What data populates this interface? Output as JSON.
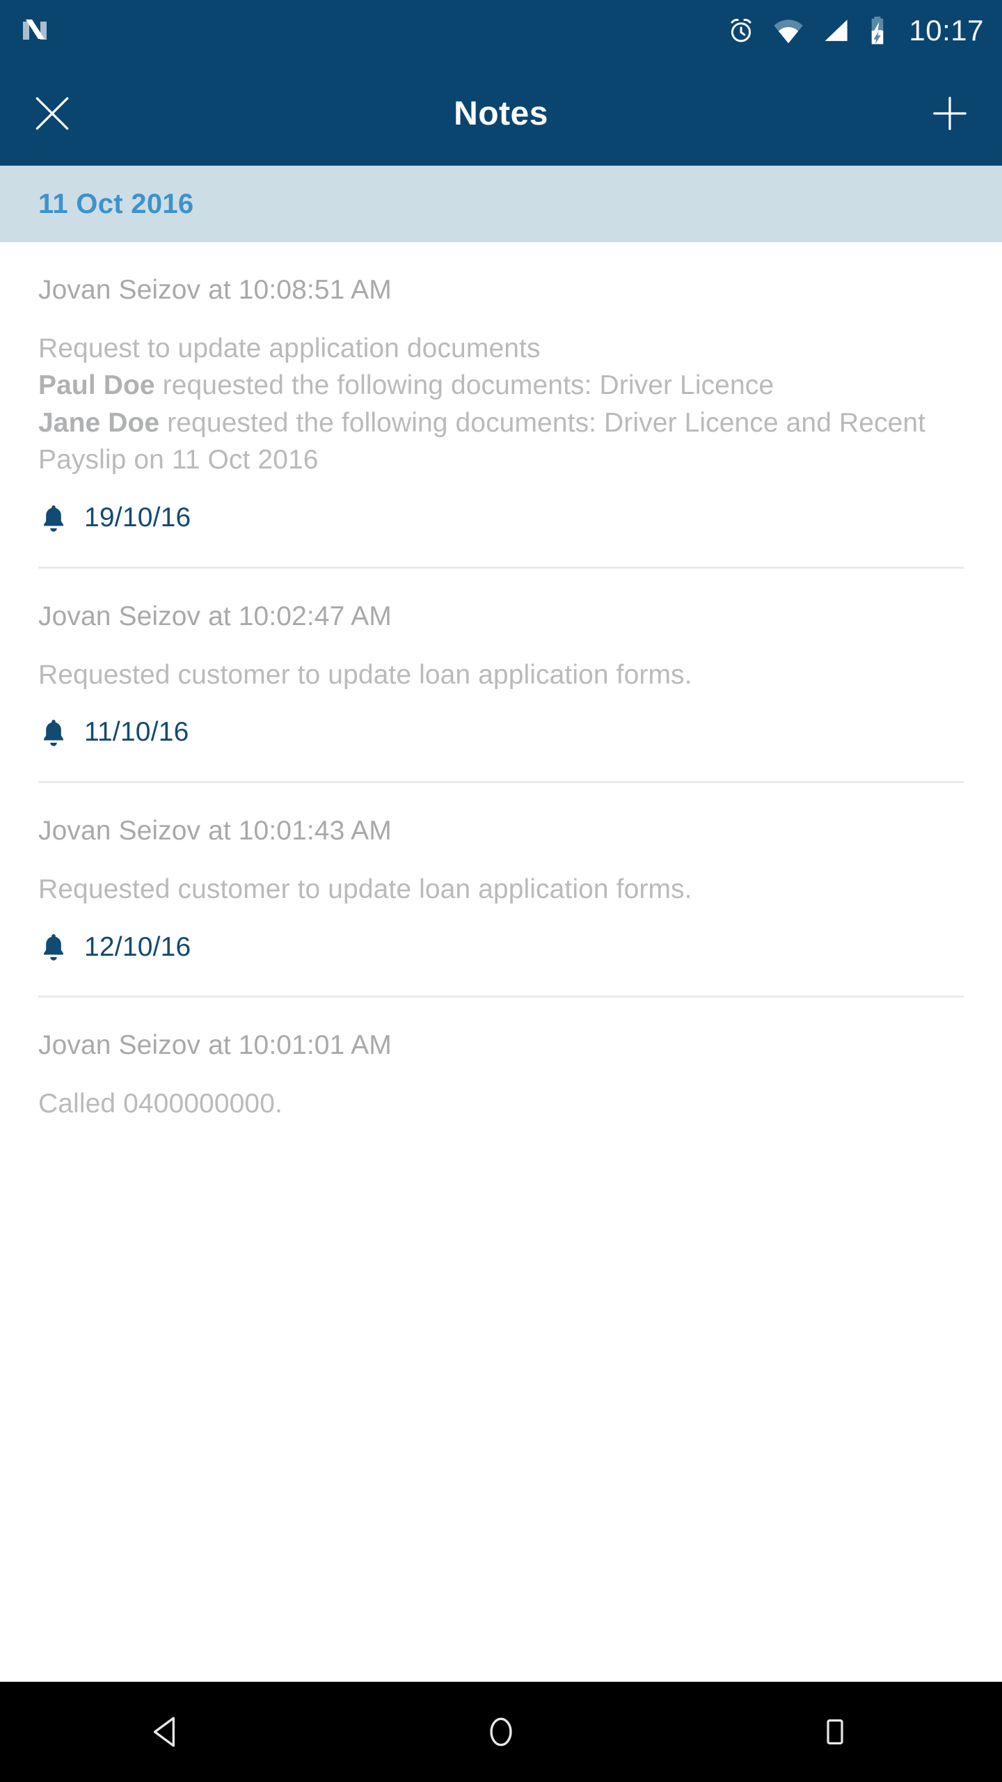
{
  "status_bar": {
    "logo_icon": "android-nougat-logo",
    "icons": [
      "alarm-icon",
      "wifi-icon",
      "signal-icon",
      "battery-charging-icon"
    ],
    "clock": "10:17"
  },
  "app_bar": {
    "close_icon": "close-icon",
    "title": "Notes",
    "add_icon": "plus-icon"
  },
  "date_band": {
    "label": "11 Oct 2016"
  },
  "notes": [
    {
      "author": "Jovan Seizov at 10:08:51 AM",
      "lines": [
        {
          "text": "Request to update application documents"
        },
        {
          "bold": "Paul Doe",
          "text": " requested the following documents: Driver Licence"
        },
        {
          "bold": "Jane Doe",
          "text": " requested the following documents: Driver Licence and Recent Payslip on 11 Oct 2016"
        }
      ],
      "reminder_icon": "bell-icon",
      "reminder_date": "19/10/16"
    },
    {
      "author": "Jovan Seizov at 10:02:47 AM",
      "lines": [
        {
          "text": "Requested customer to update loan application forms."
        }
      ],
      "reminder_icon": "bell-icon",
      "reminder_date": "11/10/16"
    },
    {
      "author": "Jovan Seizov at 10:01:43 AM",
      "lines": [
        {
          "text": "Requested customer to update loan application forms."
        }
      ],
      "reminder_icon": "bell-icon",
      "reminder_date": "12/10/16"
    },
    {
      "author": "Jovan Seizov at 10:01:01 AM",
      "lines": [
        {
          "text": "Called 0400000000."
        }
      ],
      "reminder_icon": null,
      "reminder_date": null
    }
  ],
  "nav_bar": {
    "back_icon": "back-triangle-icon",
    "home_icon": "home-circle-icon",
    "recents_icon": "recents-square-icon"
  },
  "colors": {
    "header_blue": "#0a4570",
    "date_band_bg": "#cddde6",
    "date_band_text": "#3d92cc",
    "body_text": "#b9babb",
    "author_text": "#a8a9aa",
    "reminder_blue": "#114a72",
    "divider": "#e9eaea",
    "nav_bg": "#000000"
  }
}
